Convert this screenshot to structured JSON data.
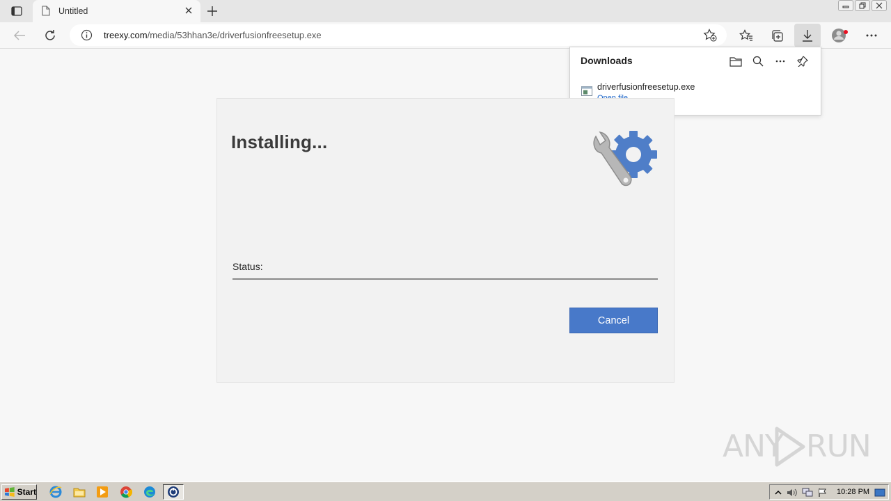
{
  "browser": {
    "tab_title": "Untitled",
    "url_host": "treexy.com",
    "url_path": "/media/53hhan3e/driverfusionfreesetup.exe"
  },
  "downloads": {
    "title": "Downloads",
    "item": {
      "filename": "driverfusionfreesetup.exe",
      "action": "Open file"
    }
  },
  "installer": {
    "heading": "Installing...",
    "status_label": "Status:",
    "progress_fraction": 0.0,
    "cancel_label": "Cancel",
    "accent_color": "#4879c9"
  },
  "watermark": {
    "left": "ANY",
    "right": "RUN"
  },
  "taskbar": {
    "start_label": "Start",
    "clock": "10:28 PM",
    "apps": [
      "ie-icon",
      "folder-icon",
      "media-player-icon",
      "chrome-icon",
      "edge-icon",
      "installer-icon"
    ]
  }
}
